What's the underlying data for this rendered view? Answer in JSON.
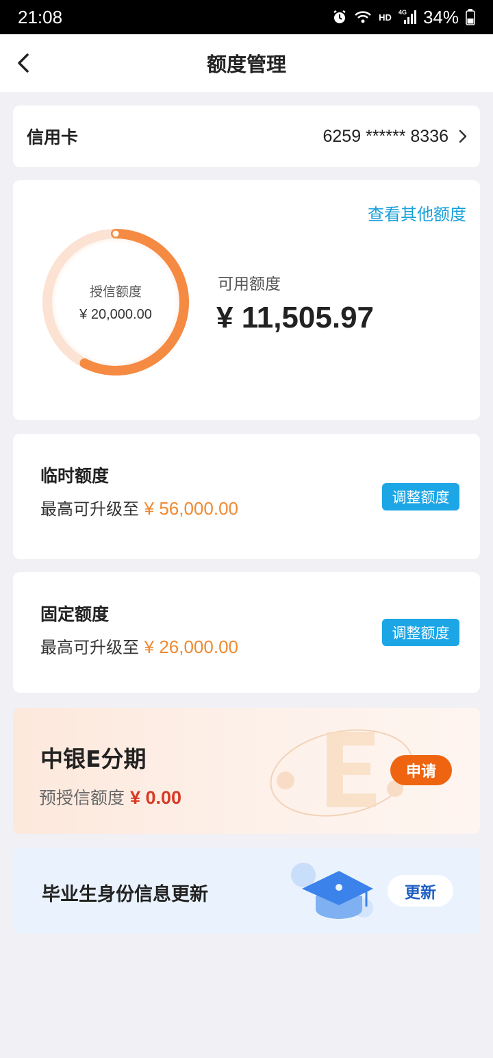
{
  "status_bar": {
    "time": "21:08",
    "hd": "HD",
    "network": "4G",
    "battery": "34%",
    "icons": [
      "alarm-icon",
      "wifi-icon",
      "signal-icon",
      "battery-icon"
    ]
  },
  "nav": {
    "title": "额度管理",
    "back_icon": "chevron-left-icon"
  },
  "card_selector": {
    "label": "信用卡",
    "number": "6259 ****** 8336",
    "icon": "chevron-right-icon"
  },
  "credit": {
    "link_other": "查看其他额度",
    "granted_label": "授信额度",
    "granted_value": "¥ 20,000.00",
    "available_label": "可用额度",
    "available_value": "¥ 11,505.97",
    "available_ratio": 0.575,
    "ring_color": "#f58a42"
  },
  "temp_limit": {
    "title": "临时额度",
    "sub_prefix": "最高可升级至 ",
    "amount": "¥ 56,000.00",
    "button": "调整额度"
  },
  "fixed_limit": {
    "title": "固定额度",
    "sub_prefix": "最高可升级至 ",
    "amount": "¥ 26,000.00",
    "button": "调整额度"
  },
  "installment": {
    "title": "中银E分期",
    "sub_prefix": "预授信额度 ",
    "amount": "¥ 0.00",
    "button": "申请"
  },
  "graduate": {
    "title": "毕业生身份信息更新",
    "button": "更新",
    "icon": "graduation-cap-icon"
  },
  "colors": {
    "accent_blue": "#1ca6e6",
    "accent_orange": "#ef8a32",
    "apply_orange": "#ee6410",
    "link_blue": "#1aa0d8"
  }
}
